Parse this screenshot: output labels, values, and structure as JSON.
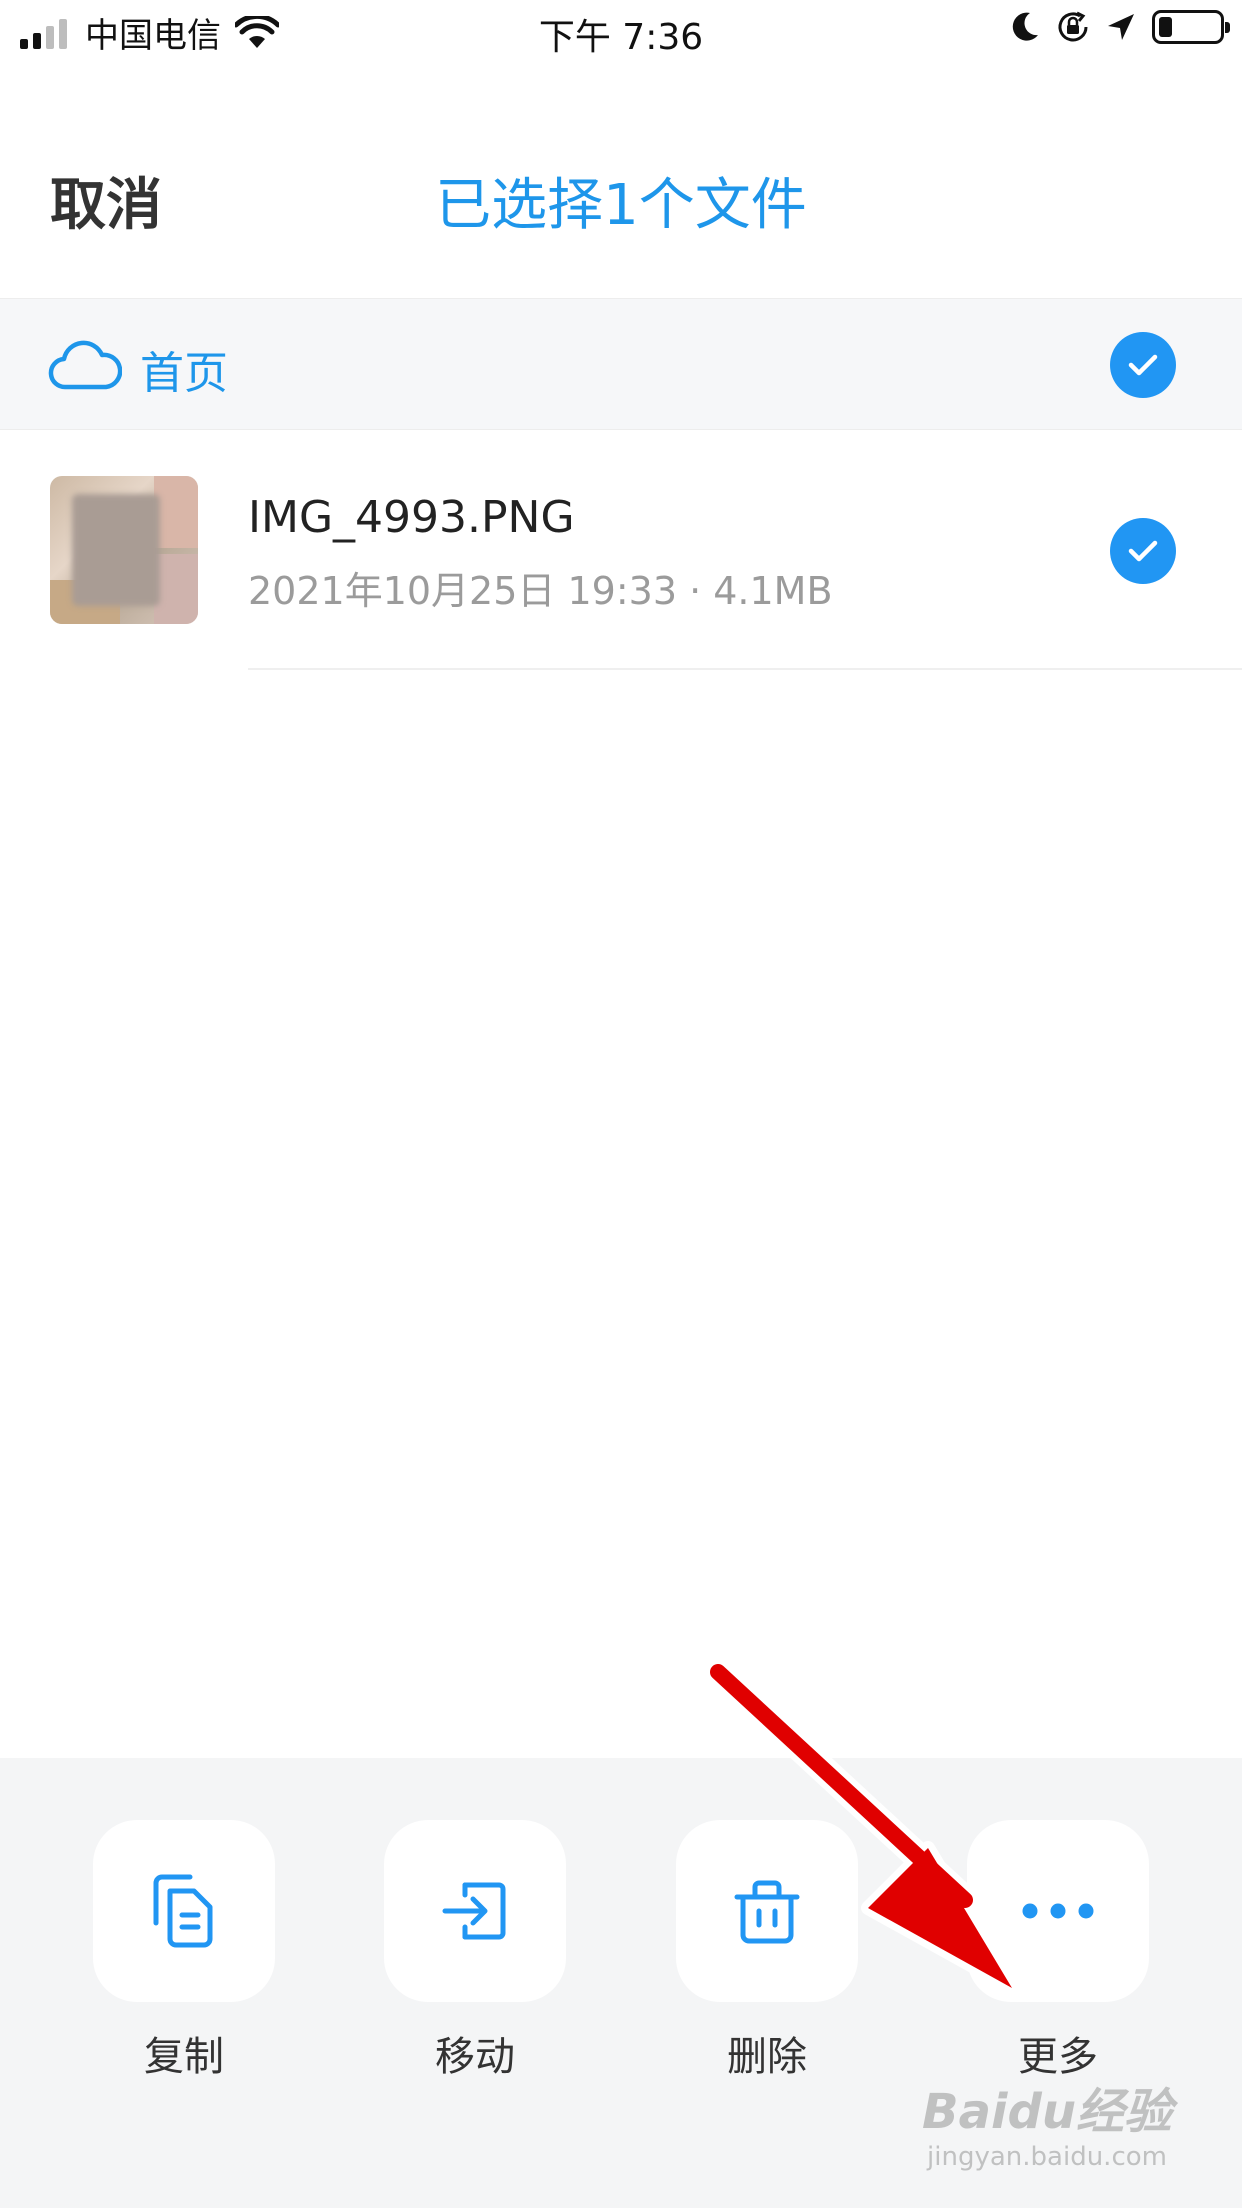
{
  "status_bar": {
    "carrier": "中国电信",
    "time": "下午 7:36"
  },
  "header": {
    "cancel_label": "取消",
    "title": "已选择1个文件"
  },
  "breadcrumb": {
    "label": "首页"
  },
  "file": {
    "name": "IMG_4993.PNG",
    "meta": "2021年10月25日 19:33 · 4.1MB"
  },
  "actions": [
    {
      "label": "复制",
      "icon": "copy-icon"
    },
    {
      "label": "移动",
      "icon": "move-icon"
    },
    {
      "label": "删除",
      "icon": "delete-icon"
    },
    {
      "label": "更多",
      "icon": "more-icon"
    }
  ],
  "watermark": {
    "main": "Baidu经验",
    "sub": "jingyan.baidu.com"
  },
  "colors": {
    "accent": "#1e96ea",
    "check": "#2196f3",
    "arrow": "#e00000"
  }
}
